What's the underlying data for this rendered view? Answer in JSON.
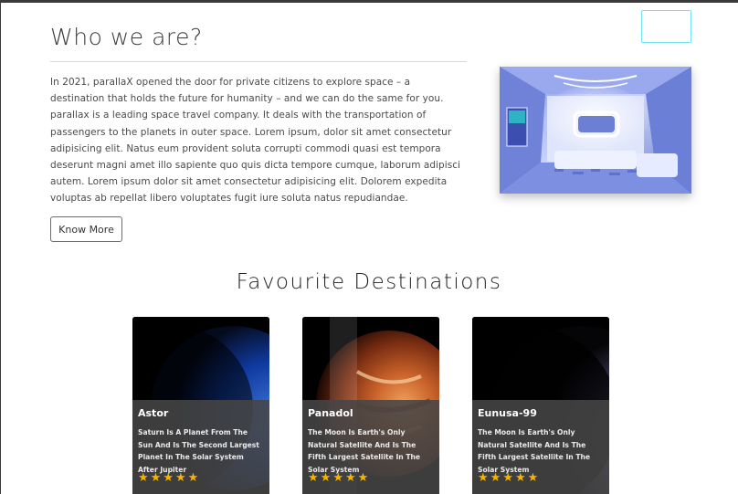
{
  "about": {
    "title": "Who we are?",
    "paragraph": "In 2021, parallaX opened the door for private citizens to explore space – a destination that holds the future for humanity – and we can do the same for you. parallax is a leading space travel company. It deals with the transportation of passengers to the planets in outer space. Lorem ipsum, dolor sit amet consectetur adipisicing elit. Natus eum provident soluta corrupti commodi quasi est tempora deserunt magni amet illo sapiente quo quis dicta tempore cumque, laborum adipisci autem. Lorem ipsum dolor sit amet consectetur adipisicing elit. Dolorem expedita voluptas ab repellat libero voluptates fugit iure soluta natus repudiandae.",
    "button_label": "Know More"
  },
  "destinations": {
    "title": "Favourite Destinations",
    "cards": [
      {
        "name": "Astor",
        "description": "Saturn Is A Planet From The Sun And Is The Second Largest Planet In The Solar System After Jupiter",
        "rating": 5
      },
      {
        "name": "Panadol",
        "description": "The Moon Is Earth's Only Natural Satellite And Is The Fifth Largest Satellite In The Solar System",
        "rating": 5
      },
      {
        "name": "Eunusa-99",
        "description": "The Moon Is Earth's Only Natural Satellite And Is The Fifth Largest Satellite In The Solar System",
        "rating": 5
      }
    ]
  },
  "colors": {
    "accent_cyan": "#6fe3ef",
    "star": "#f5b400",
    "card_overlay": "#464646"
  }
}
